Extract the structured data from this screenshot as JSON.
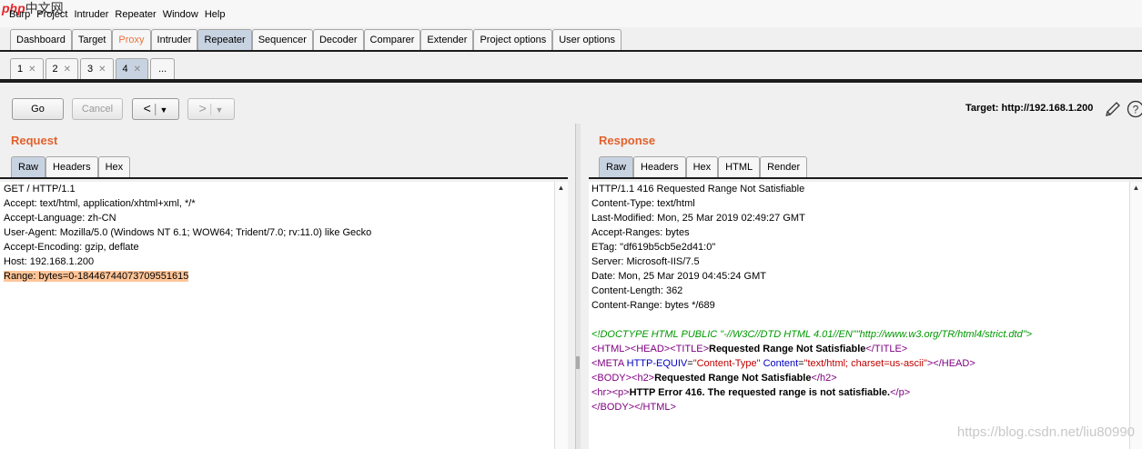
{
  "menu": {
    "logo_php": "php",
    "logo_cn": "中文网",
    "items": [
      "Burp",
      "Project",
      "Intruder",
      "Repeater",
      "Window",
      "Help"
    ]
  },
  "main_tabs": [
    "Dashboard",
    "Target",
    "Proxy",
    "Intruder",
    "Repeater",
    "Sequencer",
    "Decoder",
    "Comparer",
    "Extender",
    "Project options",
    "User options"
  ],
  "repeater_tabs": [
    "1",
    "2",
    "3",
    "4",
    "..."
  ],
  "toolbar": {
    "go": "Go",
    "cancel": "Cancel",
    "target": "Target: http://192.168.1.200"
  },
  "request": {
    "title": "Request",
    "tabs": [
      "Raw",
      "Headers",
      "Hex"
    ],
    "lines": [
      "GET / HTTP/1.1",
      "Accept: text/html, application/xhtml+xml, */*",
      "Accept-Language: zh-CN",
      "User-Agent: Mozilla/5.0 (Windows NT 6.1; WOW64; Trident/7.0; rv:11.0) like Gecko",
      "Accept-Encoding: gzip, deflate",
      "Host: 192.168.1.200",
      "Range: bytes=0-18446744073709551615"
    ]
  },
  "response": {
    "title": "Response",
    "tabs": [
      "Raw",
      "Headers",
      "Hex",
      "HTML",
      "Render"
    ],
    "lines": [
      "HTTP/1.1 416 Requested Range Not Satisfiable",
      "Content-Type: text/html",
      "Last-Modified: Mon, 25 Mar 2019 02:49:27 GMT",
      "Accept-Ranges: bytes",
      "ETag: \"df619b5cb5e2d41:0\"",
      "Server: Microsoft-IIS/7.5",
      "Date: Mon, 25 Mar 2019 04:45:24 GMT",
      "Content-Length: 362",
      "Content-Range: bytes */689"
    ],
    "html": {
      "doctype": "<!DOCTYPE HTML PUBLIC \"-//W3C//DTD HTML 4.01//EN\"\"http://www.w3.org/TR/html4/strict.dtd\">",
      "title_text": "Requested Range Not Satisfiable",
      "meta_content_value": "text/html; charset=us-ascii",
      "h2_text": "Requested Range Not Satisfiable",
      "p_text": "HTTP Error 416. The requested range is not satisfiable."
    }
  },
  "watermark": "https://blog.csdn.net/liu80990"
}
